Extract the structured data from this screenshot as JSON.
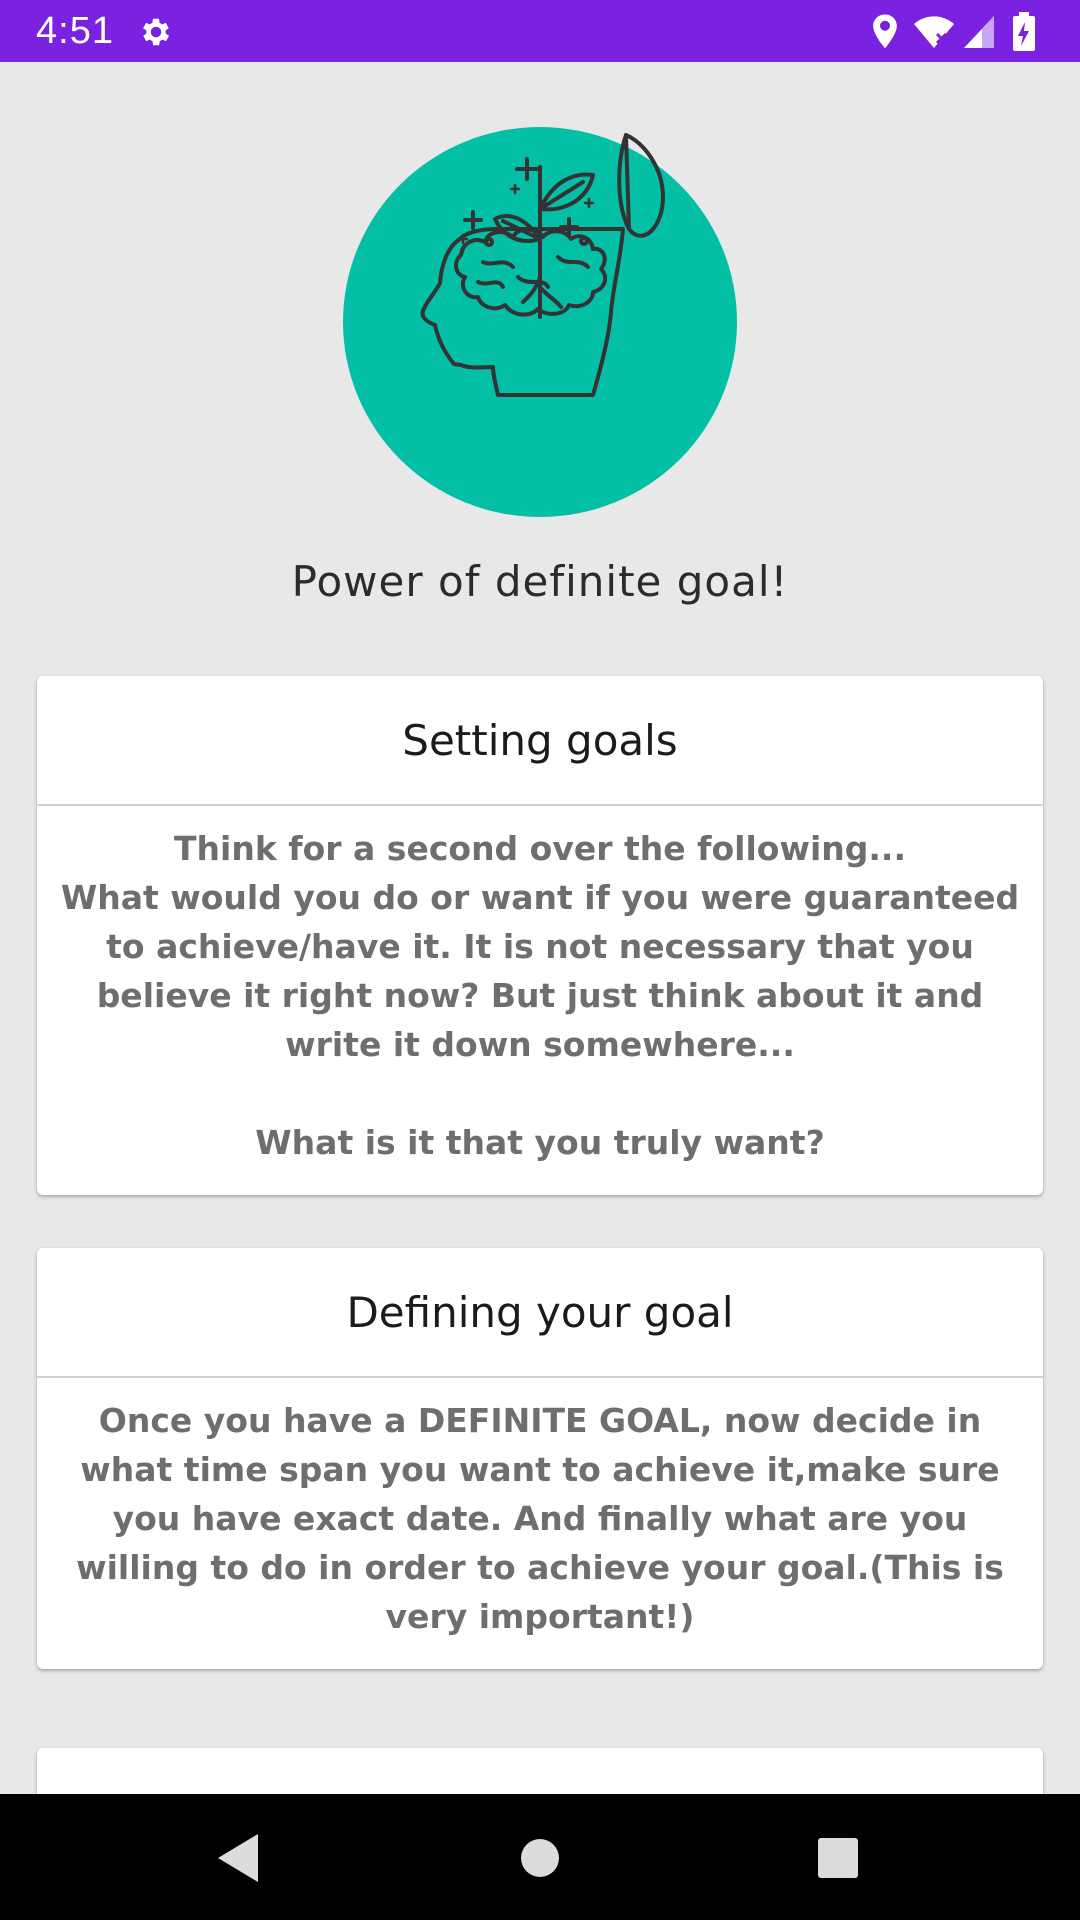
{
  "status_bar": {
    "time": "4:51",
    "background": "#7a22e0",
    "icons": [
      "settings-icon",
      "location-icon",
      "wifi-icon",
      "signal-icon",
      "battery-charging-icon"
    ]
  },
  "hero": {
    "icon": "brain-growth-icon",
    "circle_color": "#02bfa6",
    "title": "Power of definite goal!"
  },
  "cards": [
    {
      "title": "Setting goals",
      "body": "Think for a second over the following...\nWhat would you do or want if you were guaranteed to achieve/have it. It is not necessary that you believe it right now? But just think about it and write it down somewhere...\n\nWhat is it that you truly want?"
    },
    {
      "title": "Defining your goal",
      "body": "Once you have a DEFINITE GOAL, now decide in what time span you want to achieve it,make sure you have exact date. And finally what are you willing to do in order to achieve your goal.(This is very important!)"
    }
  ],
  "nav_bar": {
    "buttons": [
      "back-icon",
      "home-icon",
      "recents-icon"
    ]
  }
}
